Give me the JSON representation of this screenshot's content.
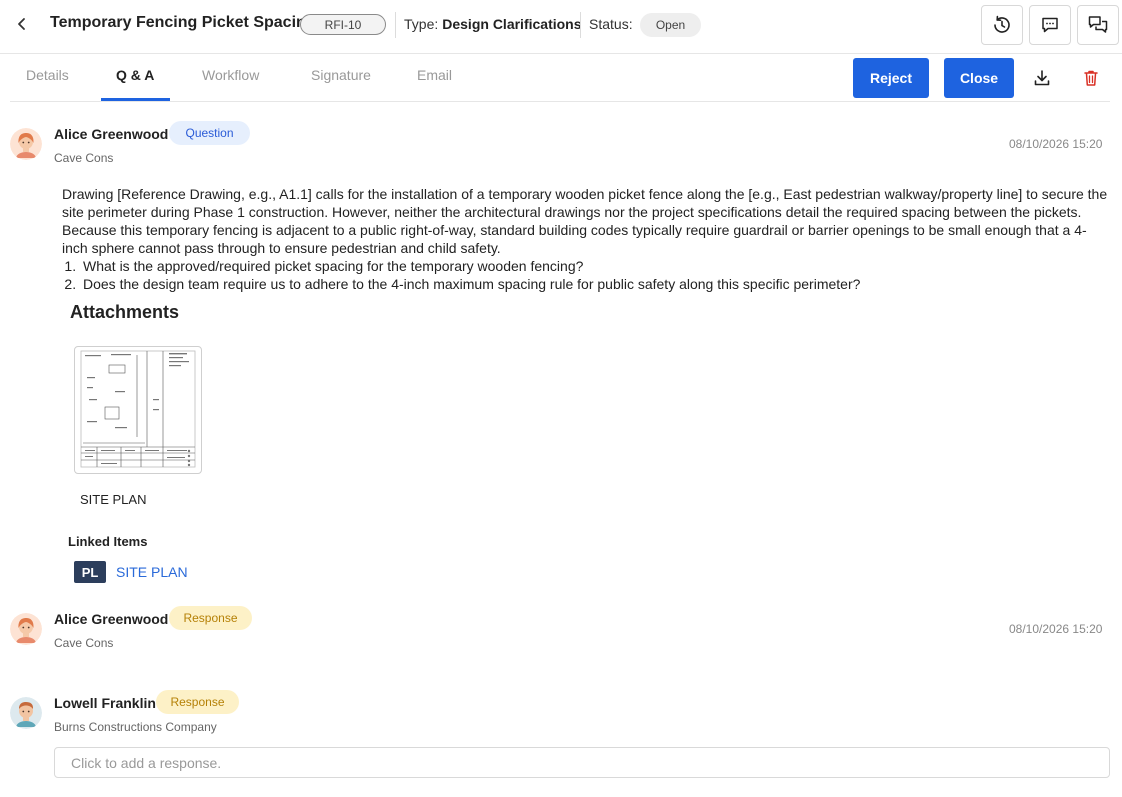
{
  "header": {
    "title": "Temporary Fencing Picket Spacing",
    "rfi_id": "RFI-10",
    "type_label": "Type:",
    "type_value": "Design Clarifications",
    "status_label": "Status:",
    "status_value": "Open"
  },
  "tabs": [
    {
      "label": "Details"
    },
    {
      "label": "Q & A"
    },
    {
      "label": "Workflow"
    },
    {
      "label": "Signature"
    },
    {
      "label": "Email"
    }
  ],
  "actions": {
    "reject_label": "Reject",
    "close_label": "Close"
  },
  "colors": {
    "accent": "#1e63e0",
    "question_badge_bg": "#e6effd",
    "response_badge_bg": "#fdf1c7",
    "danger": "#d93025"
  },
  "messages": [
    {
      "author": "Alice Greenwood",
      "badge": "Question",
      "company": "Cave Cons",
      "timestamp": "08/10/2026 15:20",
      "body": "Drawing [Reference Drawing, e.g., A1.1] calls for the installation of a temporary wooden picket fence along the [e.g., East pedestrian walkway/property line] to secure the site perimeter during Phase 1 construction. However, neither the architectural drawings nor the project specifications detail the required spacing between the pickets. Because this temporary fencing is adjacent to a public right-of-way, standard building codes typically require guardrail or barrier openings to be small enough that a 4-inch sphere cannot pass through to ensure pedestrian and child safety.",
      "questions": [
        "What is the approved/required picket spacing for the temporary wooden fencing?",
        "Does the design team require us to adhere to the 4-inch maximum spacing rule for public safety along this specific perimeter?"
      ],
      "attachments_title": "Attachments",
      "attachments": [
        {
          "name": "SITE PLAN"
        }
      ],
      "linked_title": "Linked Items",
      "linked": [
        {
          "badge": "PL",
          "label": "SITE PLAN"
        }
      ]
    },
    {
      "author": "Alice Greenwood",
      "badge": "Response",
      "company": "Cave Cons",
      "timestamp": "08/10/2026 15:20"
    },
    {
      "author": "Lowell Franklin",
      "badge": "Response",
      "company": "Burns Constructions Company"
    }
  ],
  "response_input": {
    "placeholder": "Click to add a response."
  }
}
